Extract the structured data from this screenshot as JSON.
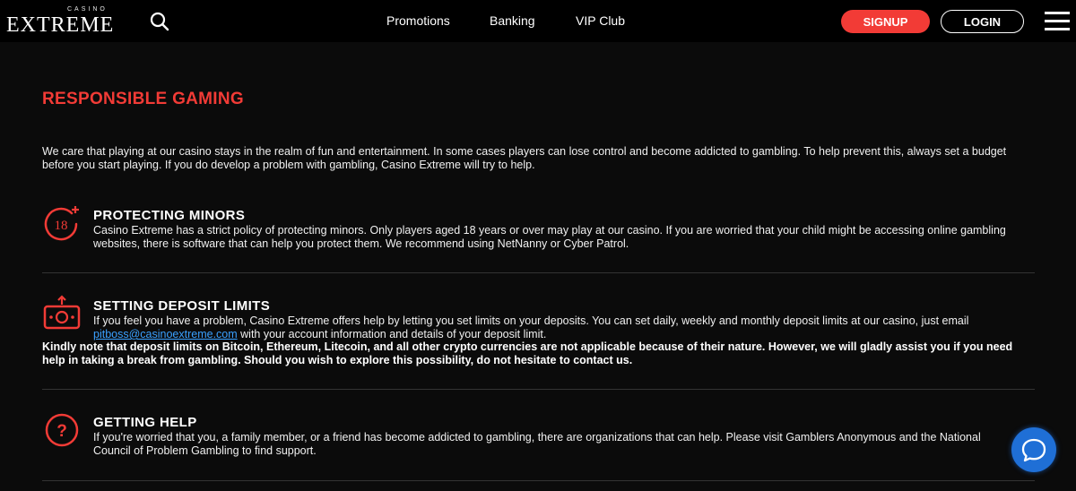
{
  "header": {
    "logo_small": "CASINO",
    "logo_main": "EXTREME",
    "nav": [
      "Promotions",
      "Banking",
      "VIP Club"
    ],
    "signup_label": "SIGNUP",
    "login_label": "LOGIN"
  },
  "page": {
    "title": "RESPONSIBLE GAMING",
    "intro": "We care that playing at our casino stays in the realm of fun and entertainment. In some cases players can lose control and become addicted to gambling. To help prevent this, always set a budget before you start playing. If you do develop a problem with gambling, Casino Extreme will try to help."
  },
  "sections": [
    {
      "icon": "18-plus-icon",
      "heading": "PROTECTING MINORS",
      "text": "Casino Extreme has a strict policy of protecting minors. Only players aged 18 years or over may play at our casino. If you are worried that your child might be accessing online gambling websites, there is software that can help you protect them. We recommend using NetNanny or Cyber Patrol."
    },
    {
      "icon": "deposit-limit-icon",
      "heading": "SETTING DEPOSIT LIMITS",
      "text": "If you feel you have a problem, Casino Extreme offers help by letting you set limits on your deposits. You can set daily, weekly and monthly deposit limits at our casino, just email",
      "email": "pitboss@casinoextreme.com",
      "text_after": " with your account information and details of your deposit limit.",
      "note": "Kindly note that deposit limits on Bitcoin, Ethereum, Litecoin, and all other crypto currencies are not applicable because of their nature. However, we will gladly assist you if you need help in taking a break from gambling. Should you wish to explore this possibility, do not hesitate to contact us."
    },
    {
      "icon": "question-icon",
      "heading": "GETTING HELP",
      "text": "If you're worried that you, a family member, or a friend has become addicted to gambling, there are organizations that can help. Please visit Gamblers Anonymous and the National Council of Problem Gambling to find support."
    }
  ],
  "colors": {
    "accent": "#f23b36",
    "background": "#0b0b0b",
    "header_bg": "#000000",
    "link": "#3aa0ff",
    "chat": "#1f6fd6"
  }
}
